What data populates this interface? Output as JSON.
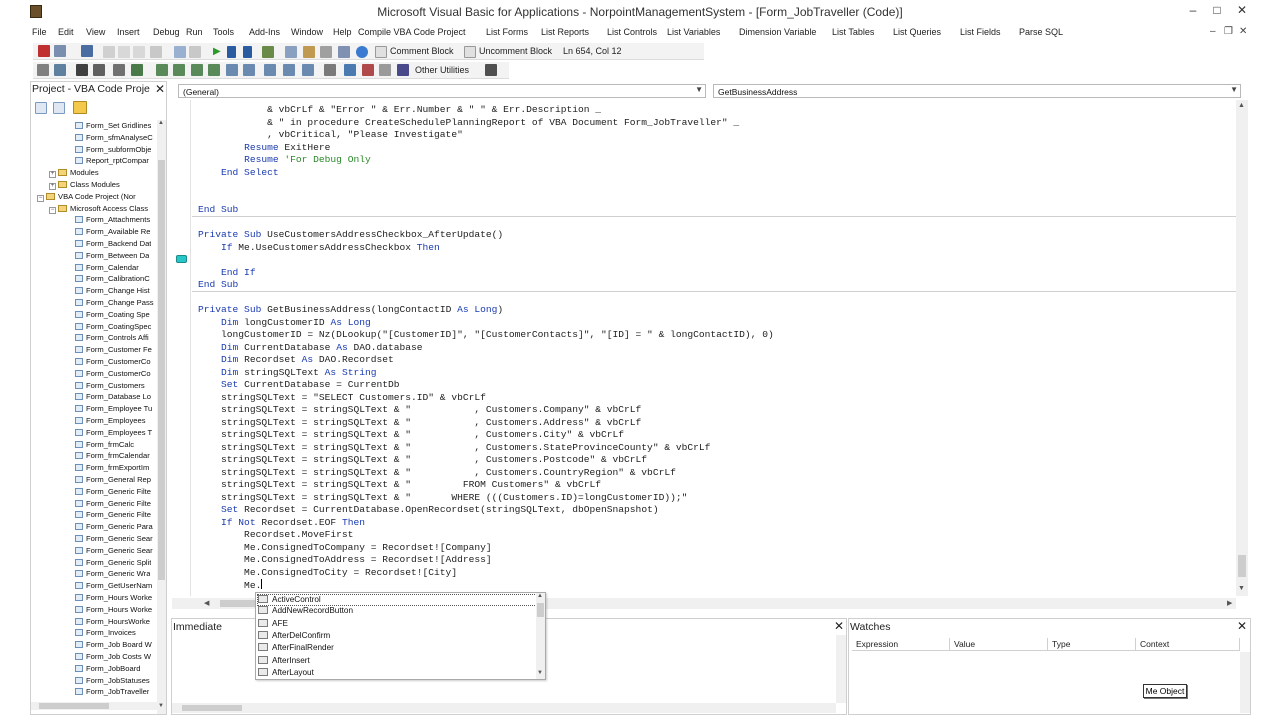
{
  "window": {
    "title": "Microsoft Visual Basic for Applications - NorpointManagementSystem - [Form_JobTraveller (Code)]",
    "minimize": "–",
    "maximize": "□",
    "close": "✕"
  },
  "menu": {
    "items": [
      "File",
      "Edit",
      "View",
      "Insert",
      "Debug",
      "Run",
      "Tools",
      "Add-Ins",
      "Window",
      "Help",
      "Compile VBA Code Project",
      "List Forms",
      "List Reports",
      "List Controls",
      "List Variables",
      "Dimension Variable",
      "List Tables",
      "List Queries",
      "List Fields",
      "Parse SQL"
    ],
    "mdi_minimize": "–",
    "mdi_restore": "❐",
    "mdi_close": "✕"
  },
  "toolbar1": {
    "comment_block": "Comment Block",
    "uncomment_block": "Uncomment Block",
    "cursor_position": "Ln 654, Col 12"
  },
  "toolbar2": {
    "other_utilities": "Other Utilities"
  },
  "project": {
    "title": "Project - VBA Code Proje",
    "close": "✕",
    "tree": [
      {
        "label": "Form_Set Gridlines",
        "kind": "item",
        "indent": 2
      },
      {
        "label": "Form_sfmAnalyseC",
        "kind": "item",
        "indent": 2
      },
      {
        "label": "Form_subformObje",
        "kind": "item",
        "indent": 2
      },
      {
        "label": "Report_rptCompar",
        "kind": "item",
        "indent": 2
      },
      {
        "label": "Modules",
        "kind": "folder",
        "indent": 1,
        "exp": "+"
      },
      {
        "label": "Class Modules",
        "kind": "folder",
        "indent": 1,
        "exp": "+"
      },
      {
        "label": "VBA Code Project (Nor",
        "kind": "project",
        "indent": 0,
        "exp": "−"
      },
      {
        "label": "Microsoft Access Class",
        "kind": "folder",
        "indent": 1,
        "exp": "−"
      },
      {
        "label": "Form_Attachments",
        "kind": "item",
        "indent": 2
      },
      {
        "label": "Form_Available Re",
        "kind": "item",
        "indent": 2
      },
      {
        "label": "Form_Backend Dat",
        "kind": "item",
        "indent": 2
      },
      {
        "label": "Form_Between Da",
        "kind": "item",
        "indent": 2
      },
      {
        "label": "Form_Calendar",
        "kind": "item",
        "indent": 2
      },
      {
        "label": "Form_CalibrationC",
        "kind": "item",
        "indent": 2
      },
      {
        "label": "Form_Change Hist",
        "kind": "item",
        "indent": 2
      },
      {
        "label": "Form_Change Pass",
        "kind": "item",
        "indent": 2
      },
      {
        "label": "Form_Coating Spe",
        "kind": "item",
        "indent": 2
      },
      {
        "label": "Form_CoatingSpec",
        "kind": "item",
        "indent": 2
      },
      {
        "label": "Form_Controls Affi",
        "kind": "item",
        "indent": 2
      },
      {
        "label": "Form_Customer Fe",
        "kind": "item",
        "indent": 2
      },
      {
        "label": "Form_CustomerCo",
        "kind": "item",
        "indent": 2
      },
      {
        "label": "Form_CustomerCo",
        "kind": "item",
        "indent": 2
      },
      {
        "label": "Form_Customers",
        "kind": "item",
        "indent": 2
      },
      {
        "label": "Form_Database Lo",
        "kind": "item",
        "indent": 2
      },
      {
        "label": "Form_Employee Tu",
        "kind": "item",
        "indent": 2
      },
      {
        "label": "Form_Employees",
        "kind": "item",
        "indent": 2
      },
      {
        "label": "Form_Employees T",
        "kind": "item",
        "indent": 2
      },
      {
        "label": "Form_frmCalc",
        "kind": "item",
        "indent": 2
      },
      {
        "label": "Form_frmCalendar",
        "kind": "item",
        "indent": 2
      },
      {
        "label": "Form_frmExportIm",
        "kind": "item",
        "indent": 2
      },
      {
        "label": "Form_General Rep",
        "kind": "item",
        "indent": 2
      },
      {
        "label": "Form_Generic Filte",
        "kind": "item",
        "indent": 2
      },
      {
        "label": "Form_Generic Filte",
        "kind": "item",
        "indent": 2
      },
      {
        "label": "Form_Generic Filte",
        "kind": "item",
        "indent": 2
      },
      {
        "label": "Form_Generic Para",
        "kind": "item",
        "indent": 2
      },
      {
        "label": "Form_Generic Sear",
        "kind": "item",
        "indent": 2
      },
      {
        "label": "Form_Generic Sear",
        "kind": "item",
        "indent": 2
      },
      {
        "label": "Form_Generic Split",
        "kind": "item",
        "indent": 2
      },
      {
        "label": "Form_Generic Wra",
        "kind": "item",
        "indent": 2
      },
      {
        "label": "Form_GetUserNam",
        "kind": "item",
        "indent": 2
      },
      {
        "label": "Form_Hours Worke",
        "kind": "item",
        "indent": 2
      },
      {
        "label": "Form_Hours Worke",
        "kind": "item",
        "indent": 2
      },
      {
        "label": "Form_HoursWorke",
        "kind": "item",
        "indent": 2
      },
      {
        "label": "Form_Invoices",
        "kind": "item",
        "indent": 2
      },
      {
        "label": "Form_Job Board W",
        "kind": "item",
        "indent": 2
      },
      {
        "label": "Form_Job Costs W",
        "kind": "item",
        "indent": 2
      },
      {
        "label": "Form_JobBoard",
        "kind": "item",
        "indent": 2
      },
      {
        "label": "Form_JobStatuses",
        "kind": "item",
        "indent": 2
      },
      {
        "label": "Form_JobTraveller",
        "kind": "item",
        "indent": 2
      }
    ]
  },
  "code": {
    "object_combo": "(General)",
    "procedure_combo": "GetBusinessAddress",
    "lines": [
      [
        {
          "t": "            & vbCrLf & \"Error \" & Err.Number & \" \" & Err.Description _"
        }
      ],
      [
        {
          "t": "            & \" in procedure CreateSchedulePlanningReport of VBA Document Form_JobTraveller\" _"
        }
      ],
      [
        {
          "t": "            , vbCritical, \"Please Investigate\""
        }
      ],
      [
        {
          "t": "        ",
          "c": ""
        },
        {
          "t": "Resume",
          "c": "kw"
        },
        {
          "t": " ExitHere"
        }
      ],
      [
        {
          "t": "        "
        },
        {
          "t": "Resume",
          "c": "kw"
        },
        {
          "t": " 'For Debug Only",
          "c": "cm"
        }
      ],
      [
        {
          "t": "    "
        },
        {
          "t": "End Select",
          "c": "kw"
        }
      ],
      [
        {
          "t": ""
        }
      ],
      [
        {
          "t": ""
        }
      ],
      [
        {
          "t": "End Sub",
          "c": "kw"
        }
      ],
      [
        {
          "t": ""
        }
      ],
      [
        {
          "t": "Private Sub",
          "c": "kw"
        },
        {
          "t": " UseCustomersAddressCheckbox_AfterUpdate()"
        }
      ],
      [
        {
          "t": "    "
        },
        {
          "t": "If",
          "c": "kw"
        },
        {
          "t": " Me.UseCustomersAddressCheckbox "
        },
        {
          "t": "Then",
          "c": "kw"
        }
      ],
      [
        {
          "t": ""
        }
      ],
      [
        {
          "t": "    "
        },
        {
          "t": "End If",
          "c": "kw"
        }
      ],
      [
        {
          "t": "End Sub",
          "c": "kw"
        }
      ],
      [
        {
          "t": ""
        }
      ],
      [
        {
          "t": "Private Sub",
          "c": "kw"
        },
        {
          "t": " GetBusinessAddress(longContactID "
        },
        {
          "t": "As Long",
          "c": "kw"
        },
        {
          "t": ")"
        }
      ],
      [
        {
          "t": "    "
        },
        {
          "t": "Dim",
          "c": "kw"
        },
        {
          "t": " longCustomerID "
        },
        {
          "t": "As Long",
          "c": "kw"
        }
      ],
      [
        {
          "t": "    longCustomerID = Nz(DLookup(\"[CustomerID]\", \"[CustomerContacts]\", \"[ID] = \" & longContactID), 0)"
        }
      ],
      [
        {
          "t": "    "
        },
        {
          "t": "Dim",
          "c": "kw"
        },
        {
          "t": " CurrentDatabase "
        },
        {
          "t": "As",
          "c": "kw"
        },
        {
          "t": " DAO.database"
        }
      ],
      [
        {
          "t": "    "
        },
        {
          "t": "Dim",
          "c": "kw"
        },
        {
          "t": " Recordset "
        },
        {
          "t": "As",
          "c": "kw"
        },
        {
          "t": " DAO.Recordset"
        }
      ],
      [
        {
          "t": "    "
        },
        {
          "t": "Dim",
          "c": "kw"
        },
        {
          "t": " stringSQLText "
        },
        {
          "t": "As String",
          "c": "kw"
        }
      ],
      [
        {
          "t": "    "
        },
        {
          "t": "Set",
          "c": "kw"
        },
        {
          "t": " CurrentDatabase = CurrentDb"
        }
      ],
      [
        {
          "t": "    stringSQLText = \"SELECT Customers.ID\" & vbCrLf"
        }
      ],
      [
        {
          "t": "    stringSQLText = stringSQLText & \"           , Customers.Company\" & vbCrLf"
        }
      ],
      [
        {
          "t": "    stringSQLText = stringSQLText & \"           , Customers.Address\" & vbCrLf"
        }
      ],
      [
        {
          "t": "    stringSQLText = stringSQLText & \"           , Customers.City\" & vbCrLf"
        }
      ],
      [
        {
          "t": "    stringSQLText = stringSQLText & \"           , Customers.StateProvinceCounty\" & vbCrLf"
        }
      ],
      [
        {
          "t": "    stringSQLText = stringSQLText & \"           , Customers.Postcode\" & vbCrLf"
        }
      ],
      [
        {
          "t": "    stringSQLText = stringSQLText & \"           , Customers.CountryRegion\" & vbCrLf"
        }
      ],
      [
        {
          "t": "    stringSQLText = stringSQLText & \"         FROM Customers\" & vbCrLf"
        }
      ],
      [
        {
          "t": "    stringSQLText = stringSQLText & \"       WHERE (((Customers.ID)=longCustomerID));\""
        }
      ],
      [
        {
          "t": "    "
        },
        {
          "t": "Set",
          "c": "kw"
        },
        {
          "t": " Recordset = CurrentDatabase.OpenRecordset(stringSQLText, dbOpenSnapshot)"
        }
      ],
      [
        {
          "t": "    "
        },
        {
          "t": "If Not",
          "c": "kw"
        },
        {
          "t": " Recordset.EOF "
        },
        {
          "t": "Then",
          "c": "kw"
        }
      ],
      [
        {
          "t": "        Recordset.MoveFirst"
        }
      ],
      [
        {
          "t": "        Me.ConsignedToCompany = Recordset![Company]"
        }
      ],
      [
        {
          "t": "        Me.ConsignedToAddress = Recordset![Address]"
        }
      ],
      [
        {
          "t": "        Me.ConsignedToCity = Recordset![City]"
        }
      ],
      [
        {
          "t": "        Me."
        }
      ]
    ]
  },
  "autocomplete": {
    "items": [
      "ActiveControl",
      "AddNewRecordButton",
      "AFE",
      "AfterDelConfirm",
      "AfterFinalRender",
      "AfterInsert",
      "AfterLayout"
    ]
  },
  "immediate": {
    "title": "Immediate",
    "close": "✕"
  },
  "watches": {
    "title": "Watches",
    "close": "✕",
    "columns": [
      "Expression",
      "Value",
      "Type",
      "Context"
    ],
    "tooltip": "Me Object"
  },
  "colors": {
    "keyword": "#1a3bb0",
    "comment": "#2a8a2a",
    "bookmark": "#28c7c7"
  }
}
